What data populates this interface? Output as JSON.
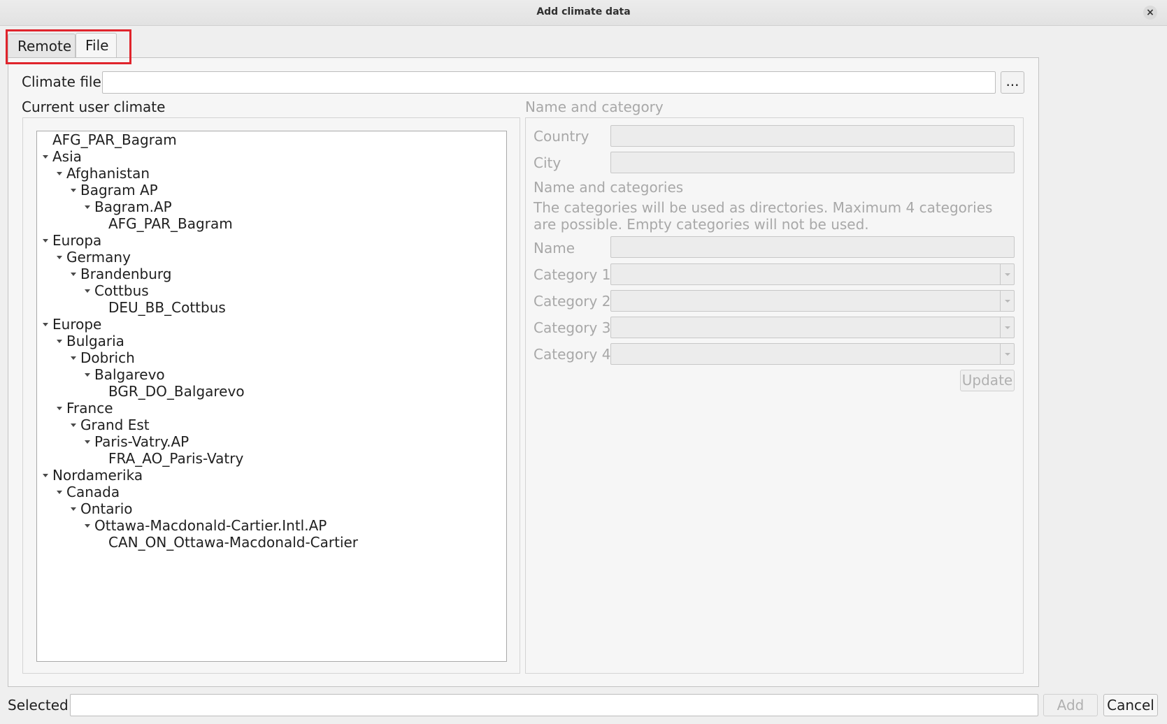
{
  "window": {
    "title": "Add climate data",
    "close_symbol": "×"
  },
  "tabs": [
    {
      "label": "Remote",
      "active": false
    },
    {
      "label": "File",
      "active": true
    }
  ],
  "climate_file": {
    "label": "Climate file",
    "value": "",
    "browse_label": "..."
  },
  "current_user_climate": {
    "label": "Current user climate",
    "tree": [
      {
        "label": "AFG_PAR_Bagram",
        "level": 0,
        "expanded": false,
        "has_children": false
      },
      {
        "label": "Asia",
        "level": 0,
        "expanded": true,
        "has_children": true
      },
      {
        "label": "Afghanistan",
        "level": 1,
        "expanded": true,
        "has_children": true
      },
      {
        "label": "Bagram AP",
        "level": 2,
        "expanded": true,
        "has_children": true
      },
      {
        "label": "Bagram.AP",
        "level": 3,
        "expanded": true,
        "has_children": true
      },
      {
        "label": "AFG_PAR_Bagram",
        "level": 4,
        "expanded": false,
        "has_children": false
      },
      {
        "label": "Europa",
        "level": 0,
        "expanded": true,
        "has_children": true
      },
      {
        "label": "Germany",
        "level": 1,
        "expanded": true,
        "has_children": true
      },
      {
        "label": "Brandenburg",
        "level": 2,
        "expanded": true,
        "has_children": true
      },
      {
        "label": "Cottbus",
        "level": 3,
        "expanded": true,
        "has_children": true
      },
      {
        "label": "DEU_BB_Cottbus",
        "level": 4,
        "expanded": false,
        "has_children": false
      },
      {
        "label": "Europe",
        "level": 0,
        "expanded": true,
        "has_children": true
      },
      {
        "label": "Bulgaria",
        "level": 1,
        "expanded": true,
        "has_children": true
      },
      {
        "label": "Dobrich",
        "level": 2,
        "expanded": true,
        "has_children": true
      },
      {
        "label": "Balgarevo",
        "level": 3,
        "expanded": true,
        "has_children": true
      },
      {
        "label": "BGR_DO_Balgarevo",
        "level": 4,
        "expanded": false,
        "has_children": false
      },
      {
        "label": "France",
        "level": 1,
        "expanded": true,
        "has_children": true
      },
      {
        "label": "Grand Est",
        "level": 2,
        "expanded": true,
        "has_children": true
      },
      {
        "label": "Paris-Vatry.AP",
        "level": 3,
        "expanded": true,
        "has_children": true
      },
      {
        "label": "FRA_AO_Paris-Vatry",
        "level": 4,
        "expanded": false,
        "has_children": false
      },
      {
        "label": "Nordamerika",
        "level": 0,
        "expanded": true,
        "has_children": true
      },
      {
        "label": "Canada",
        "level": 1,
        "expanded": true,
        "has_children": true
      },
      {
        "label": "Ontario",
        "level": 2,
        "expanded": true,
        "has_children": true
      },
      {
        "label": "Ottawa-Macdonald-Cartier.Intl.AP",
        "level": 3,
        "expanded": true,
        "has_children": true
      },
      {
        "label": "CAN_ON_Ottawa-Macdonald-Cartier",
        "level": 4,
        "expanded": false,
        "has_children": false
      }
    ]
  },
  "name_and_category": {
    "title": "Name and category",
    "country_label": "Country",
    "country_value": "",
    "city_label": "City",
    "city_value": "",
    "subheading": "Name and categories",
    "description": "The categories will be used as directories. Maximum 4 categories are possible. Empty categories will not be used.",
    "name_label": "Name",
    "name_value": "",
    "category_labels": [
      "Category 1",
      "Category 2",
      "Category 3",
      "Category 4"
    ],
    "category_values": [
      "",
      "",
      "",
      ""
    ],
    "update_label": "Update"
  },
  "footer": {
    "selected_label": "Selected",
    "selected_value": "",
    "add_label": "Add",
    "cancel_label": "Cancel"
  },
  "colors": {
    "highlight": "#e0242c",
    "disabled_text": "#a8a8a8"
  }
}
